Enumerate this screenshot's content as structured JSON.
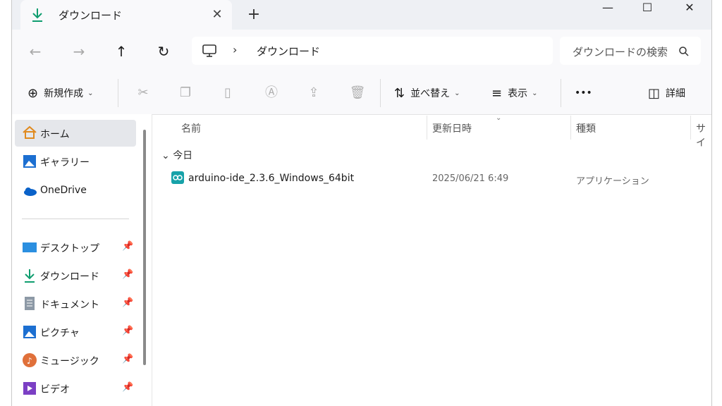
{
  "tab": {
    "title": "ダウンロード",
    "close_label": "✕",
    "new_tab_label": "+"
  },
  "window_controls": {
    "minimize": "—",
    "maximize": "☐",
    "close": "✕"
  },
  "address_bar": {
    "separator": "›",
    "breadcrumb": "ダウンロード",
    "search_placeholder": "ダウンロードの検索"
  },
  "command_bar": {
    "new_label": "新規作成",
    "sort_label": "並べ替え",
    "view_label": "表示",
    "more_label": "•••",
    "details_label": "詳細"
  },
  "sidebar": {
    "home": "ホーム",
    "gallery": "ギャラリー",
    "onedrive": "OneDrive",
    "desktop": "デスクトップ",
    "downloads": "ダウンロード",
    "documents": "ドキュメント",
    "pictures": "ピクチャ",
    "music": "ミュージック",
    "videos": "ビデオ"
  },
  "columns": {
    "name": "名前",
    "modified": "更新日時",
    "type": "種類",
    "size": "サイ"
  },
  "group_label": "今日",
  "files": [
    {
      "name": "arduino-ide_2.3.6_Windows_64bit",
      "modified": "2025/06/21 6:49",
      "type": "アプリケーション"
    }
  ],
  "colors": {
    "accent": "#0f7b9a",
    "arduino": "#17a2a9",
    "selection": "#e5e7eb"
  }
}
